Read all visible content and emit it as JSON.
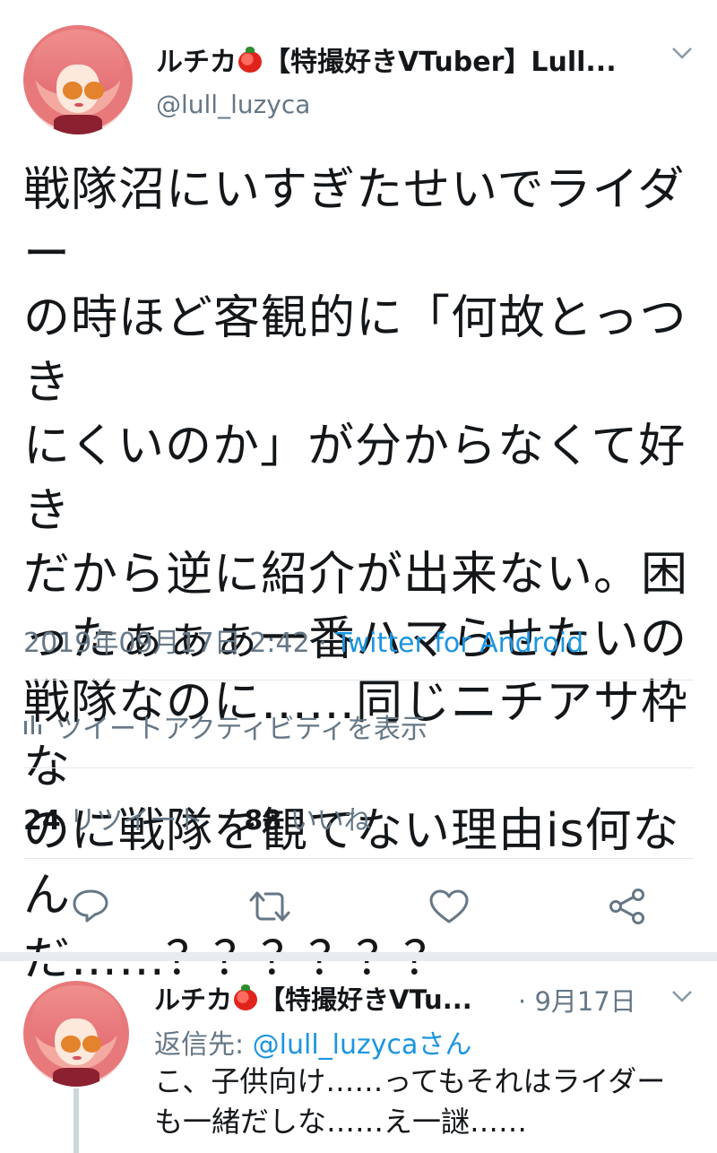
{
  "tweet": {
    "display_name": "ルチカ",
    "name_suffix": "【特撮好きVTuber】Lull...",
    "handle": "@lull_luzyca",
    "text_lines": [
      "戦隊沼にいすぎたせいでライダー",
      "の時ほど客観的に「何故とっつき",
      "にくいのか」が分からなくて好き",
      "だから逆に紹介が出来ない。困",
      "ったぁぁぁ一番ハマらせたいの",
      "戦隊なのに……同じニチアサ枠な",
      "のに戦隊を観てない理由is何なん",
      "だ……？？？？？？"
    ],
    "timestamp": "2019年09月17日 2:42",
    "separator": "·",
    "source": "Twitter for Android",
    "activity_label": "ツイートアクティビティを表示",
    "retweet_count": "24",
    "retweet_label": "リツイート",
    "like_count": "88",
    "like_label": "いいね"
  },
  "reply": {
    "display_name": "ルチカ",
    "name_suffix": "【特撮好きVTu...",
    "separator": "·",
    "date": "9月17日",
    "reply_to_label": "返信先:",
    "reply_to_handle": "@lull_luzycaさん",
    "text_lines": [
      "こ、子供向け……ってもそれはライダー",
      "も一緒だしな……え一謎……"
    ]
  },
  "icons": {
    "reply": "reply-icon",
    "retweet": "retweet-icon",
    "like": "heart-icon",
    "share": "share-icon",
    "activity": "bar-chart-icon",
    "menu": "chevron-down-icon",
    "emoji": "tomato-icon"
  },
  "colors": {
    "link": "#1b95e0",
    "secondary_text": "#657786",
    "primary_text": "#14171a",
    "divider": "#e1e8ed"
  }
}
